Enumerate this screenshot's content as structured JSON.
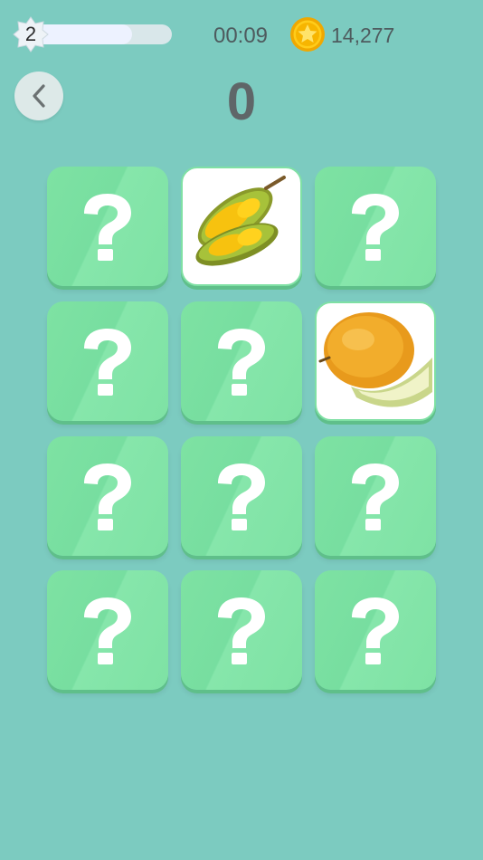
{
  "hud": {
    "level": "2",
    "level_progress": 0.72,
    "timer": "00:09",
    "coins": "14,277"
  },
  "score": "0",
  "icons": {
    "back": "chevron-left-icon",
    "coin": "coin-star-icon",
    "level": "star-badge-icon",
    "card_back": "question-mark-icon"
  },
  "colors": {
    "background": "#7ccbc0",
    "card_back": "#7ee2a3",
    "card_face": "#ffffff",
    "coin": "#f5b800"
  },
  "cards": [
    {
      "state": "hidden"
    },
    {
      "state": "revealed",
      "fruit": "durian"
    },
    {
      "state": "hidden"
    },
    {
      "state": "hidden"
    },
    {
      "state": "hidden"
    },
    {
      "state": "revealed",
      "fruit": "cantaloupe"
    },
    {
      "state": "hidden"
    },
    {
      "state": "hidden"
    },
    {
      "state": "hidden"
    },
    {
      "state": "hidden"
    },
    {
      "state": "hidden"
    },
    {
      "state": "hidden"
    }
  ]
}
